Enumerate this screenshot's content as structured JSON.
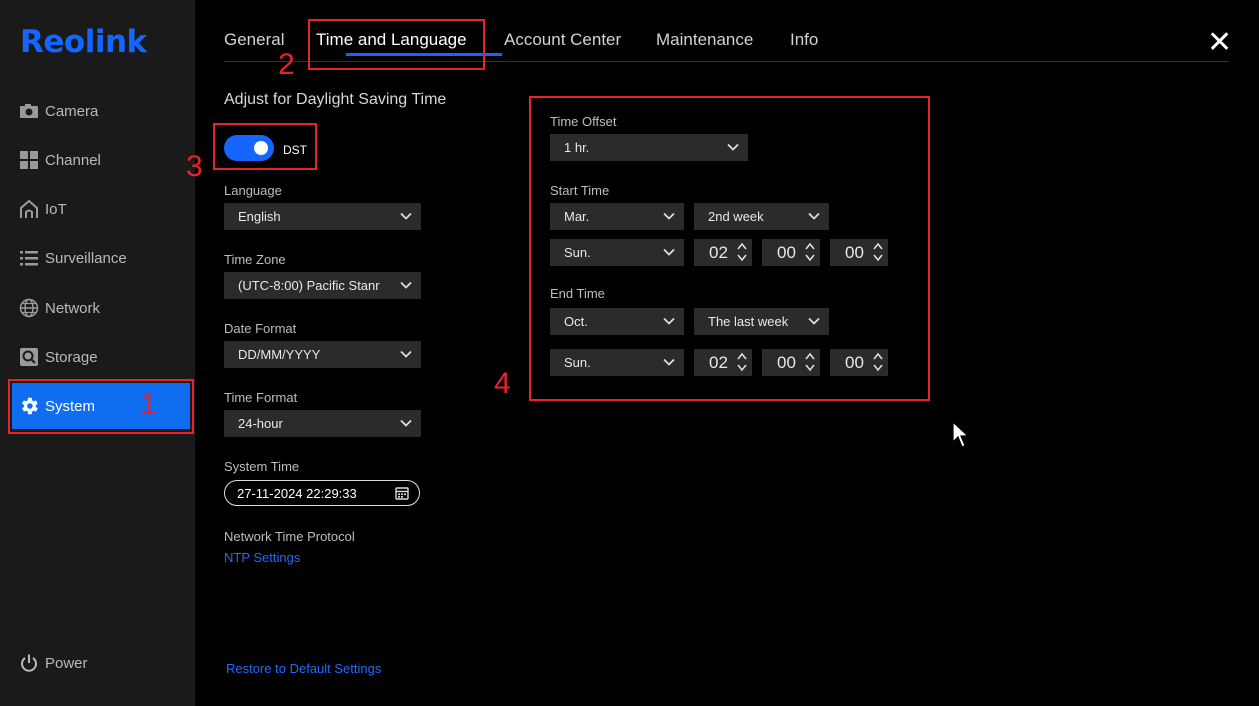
{
  "app": {
    "logo": "Reolink"
  },
  "sidebar": {
    "items": [
      {
        "label": "Camera",
        "icon": "camera-icon"
      },
      {
        "label": "Channel",
        "icon": "grid-icon"
      },
      {
        "label": "IoT",
        "icon": "home-icon"
      },
      {
        "label": "Surveillance",
        "icon": "list-icon"
      },
      {
        "label": "Network",
        "icon": "globe-icon"
      },
      {
        "label": "Storage",
        "icon": "storage-icon"
      },
      {
        "label": "System",
        "icon": "gear-icon",
        "active": true
      }
    ],
    "power_label": "Power"
  },
  "tabs": [
    {
      "label": "General"
    },
    {
      "label": "Time and Language",
      "active": true
    },
    {
      "label": "Account Center"
    },
    {
      "label": "Maintenance"
    },
    {
      "label": "Info"
    }
  ],
  "dst": {
    "title": "Adjust for Daylight Saving Time",
    "toggle_label": "DST",
    "enabled": true
  },
  "left_form": {
    "language_label": "Language",
    "language_value": "English",
    "timezone_label": "Time Zone",
    "timezone_value": "(UTC-8:00) Pacific Stanr",
    "date_format_label": "Date Format",
    "date_format_value": "DD/MM/YYYY",
    "time_format_label": "Time Format",
    "time_format_value": "24-hour",
    "system_time_label": "System Time",
    "system_time_value": "27-11-2024 22:29:33",
    "ntp_label": "Network Time Protocol",
    "ntp_link": "NTP Settings",
    "restore_link": "Restore to Default Settings"
  },
  "dst_settings": {
    "offset_label": "Time Offset",
    "offset_value": "1 hr.",
    "start_label": "Start Time",
    "start_month": "Mar.",
    "start_week": "2nd week",
    "start_day": "Sun.",
    "start_hour": "02",
    "start_min": "00",
    "start_sec": "00",
    "end_label": "End Time",
    "end_month": "Oct.",
    "end_week": "The last week",
    "end_day": "Sun.",
    "end_hour": "02",
    "end_min": "00",
    "end_sec": "00"
  },
  "annotations": [
    "1",
    "2",
    "3",
    "4"
  ],
  "colors": {
    "accent": "#1565ff",
    "active_bg": "#0f6ef0",
    "annotation": "#e8222a",
    "sidebar_bg": "#1a1a1a"
  }
}
